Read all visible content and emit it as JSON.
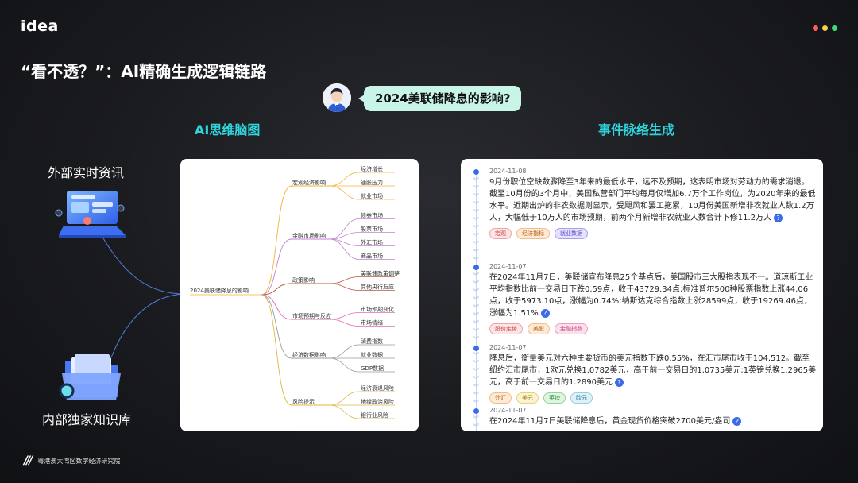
{
  "header": {
    "logo": "idea",
    "title": "“看不透？”：AI精确生成逻辑链路",
    "dots": [
      "#ff5c5c",
      "#f3d34a",
      "#3fd77a"
    ]
  },
  "question": "2024美联储降息的影响?",
  "sections": {
    "left": "AI思维脑图",
    "right": "事件脉络生成"
  },
  "sources": {
    "external": "外部实时资讯",
    "internal": "内部独家知识库"
  },
  "mindmap": {
    "root": "2024美联储降息的影响",
    "branches": [
      {
        "label": "宏观经济影响",
        "color": "#f2b233",
        "children": [
          "经济增长",
          "通胀压力",
          "就业市场"
        ]
      },
      {
        "label": "金融市场影响",
        "color": "#c77dd9",
        "children": [
          "债券市场",
          "股票市场",
          "外汇市场",
          "商品市场"
        ]
      },
      {
        "label": "政策影响",
        "color": "#b35b3e",
        "children": [
          "美联储政策调整",
          "其他央行反应"
        ]
      },
      {
        "label": "市场预期与反应",
        "color": "#e26bb0",
        "children": [
          "市场预期变化",
          "市场情绪"
        ]
      },
      {
        "label": "经济数据影响",
        "color": "#9a9a9a",
        "children": [
          "消费指数",
          "就业数据",
          "GDP数据"
        ]
      },
      {
        "label": "风险提示",
        "color": "#d9b843",
        "children": [
          "经济衰退风险",
          "地缘政治风险",
          "银行业风险"
        ]
      }
    ]
  },
  "events": [
    {
      "date": "2024-11-08",
      "text": "9月份职位空缺数骤降至3年来的最低水平，远不及预期，这表明市场对劳动力的需求消退。截至10月份的3个月中，美国私营部门平均每月仅增加6.7万个工作岗位，为2020年来的最低水平。近期出炉的非农数据则显示，受飓风和罢工拖累，10月份美国新增非农就业人数1.2万人，大幅低于10万人的市场预期，前两个月新增非农就业人数合计下修11.2万人",
      "tags": [
        {
          "label": "宏观",
          "bg": "#fde4e4",
          "border": "#f2a3a3",
          "color": "#c64545"
        },
        {
          "label": "经济指标",
          "bg": "#fde9d5",
          "border": "#f3bd8a",
          "color": "#b86a1e"
        },
        {
          "label": "就业数据",
          "bg": "#e3e1fb",
          "border": "#a7a2ee",
          "color": "#5a52c9"
        }
      ]
    },
    {
      "date": "2024-11-07",
      "text": "在2024年11月7日，美联储宣布降息25个基点后，美国股市三大股指表现不一。道琼斯工业平均指数比前一交易日下跌0.59点，收于43729.34点;标准普尔500种股票指数上涨44.06点，收于5973.10点，涨幅为0.74%;纳斯达克综合指数上涨28599点，收于19269.46点，涨幅为1.51%",
      "tags": [
        {
          "label": "股价走势",
          "bg": "#fde4e4",
          "border": "#f2a3a3",
          "color": "#c64545"
        },
        {
          "label": "美股",
          "bg": "#fde9d5",
          "border": "#f3bd8a",
          "color": "#b86a1e"
        },
        {
          "label": "金融指数",
          "bg": "#fbe0ec",
          "border": "#ee9fc1",
          "color": "#c43f7c"
        }
      ]
    },
    {
      "date": "2024-11-07",
      "text": "降息后，衡量美元对六种主要货币的美元指数下跌0.55%，在汇市尾市收于104.512。截至纽约汇市尾市，1欧元兑换1.0782美元，高于前一交易日的1.0735美元;1英镑兑换1.2965美元，高于前一交易日的1.2890美元",
      "tags": [
        {
          "label": "外汇",
          "bg": "#fde9d5",
          "border": "#f3bd8a",
          "color": "#b86a1e"
        },
        {
          "label": "美元",
          "bg": "#fbf4d2",
          "border": "#e7d37b",
          "color": "#9a7f12"
        },
        {
          "label": "英镑",
          "bg": "#dff5e1",
          "border": "#94d69b",
          "color": "#2f8a3a"
        },
        {
          "label": "欧元",
          "bg": "#dff1f7",
          "border": "#98cfe2",
          "color": "#2b7f9c"
        }
      ]
    },
    {
      "date": "2024-11-07",
      "text": "在2024年11月7日美联储降息后，黄金现货价格突破2700美元/盎司",
      "tags": []
    }
  ],
  "footer": {
    "mark": "///",
    "org": "粤港澳大湾区数字经济研究院"
  }
}
